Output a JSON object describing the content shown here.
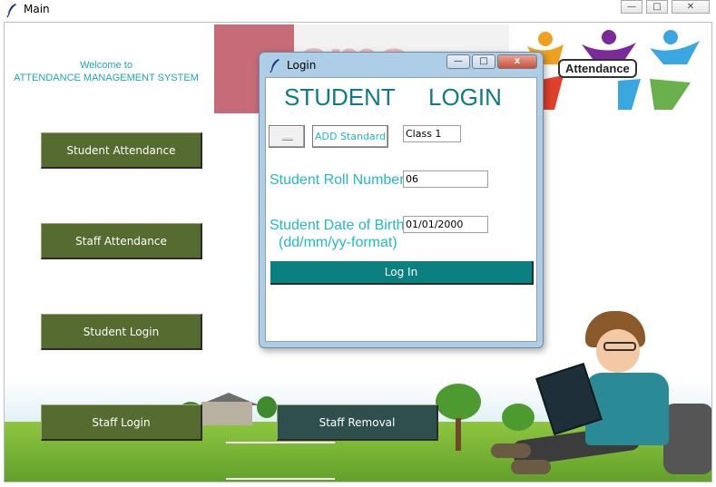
{
  "window": {
    "title": "Main",
    "controls": {
      "minimize": "—",
      "maximize": "□",
      "close": "✕"
    }
  },
  "header": {
    "welcome_line1": "Welcome to",
    "welcome_line2": "ATTENDANCE MANAGEMENT SYSTEM",
    "banner_text": "ams",
    "attendance_logo_text": "Attendance"
  },
  "buttons": {
    "student_attendance": "Student Attendance",
    "staff_attendance": "Staff Attendance",
    "student_login": "Student Login",
    "staff_login": "Staff Login",
    "staff_removal": "Staff Removal"
  },
  "login_dialog": {
    "title": "Login",
    "heading_student": "STUDENT",
    "heading_login": "LOGIN",
    "add_standard_label": "ADD Standard",
    "standard_value": "Class 1",
    "roll_number_label": "Student Roll Number",
    "roll_number_value": "06",
    "dob_label": "Student Date of Birth",
    "dob_format_label": "(dd/mm/yy-format)",
    "dob_value": "01/01/2000",
    "login_button": "Log In",
    "controls": {
      "minimize": "—",
      "maximize": "□",
      "close": "x"
    }
  },
  "colors": {
    "olive_button": "#556b2f",
    "slate_button": "#2f4f4f",
    "teal_button": "#0a8080",
    "label_cyan": "#22b8c8",
    "title_teal": "#0e7c85"
  },
  "icons": {
    "app_icon": "feather-icon"
  }
}
